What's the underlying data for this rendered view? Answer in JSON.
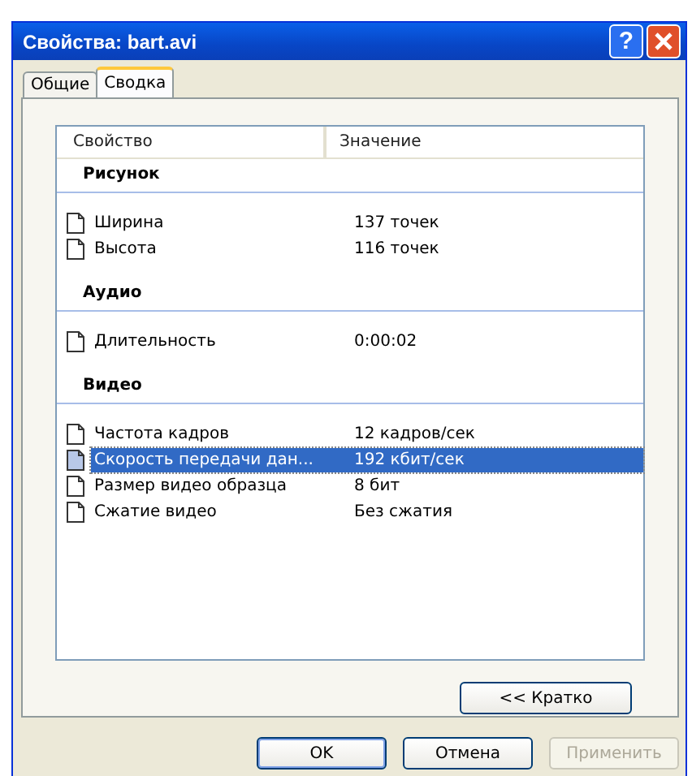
{
  "window": {
    "title": "Свойства: bart.avi",
    "help_label": "?"
  },
  "tabs": [
    {
      "label": "Общие",
      "selected": false
    },
    {
      "label": "Сводка",
      "selected": true
    }
  ],
  "list": {
    "columns": [
      "Свойство",
      "Значение"
    ],
    "groups": [
      {
        "title": "Рисунок",
        "rows": [
          {
            "name": "Ширина",
            "value": "137 точек",
            "selected": false
          },
          {
            "name": "Высота",
            "value": "116 точек",
            "selected": false
          }
        ]
      },
      {
        "title": "Аудио",
        "rows": [
          {
            "name": "Длительность",
            "value": "0:00:02",
            "selected": false
          }
        ]
      },
      {
        "title": "Видео",
        "rows": [
          {
            "name": "Частота кадров",
            "value": "12 кадров/сек",
            "selected": false
          },
          {
            "name": "Скорость передачи дан...",
            "value": "192 кбит/сек",
            "selected": true
          },
          {
            "name": "Размер видео образца",
            "value": "8 бит",
            "selected": false
          },
          {
            "name": "Сжатие видео",
            "value": "Без сжатия",
            "selected": false
          }
        ]
      }
    ]
  },
  "summary_button": "<< Кратко",
  "buttons": [
    {
      "label": "OK",
      "disabled": false,
      "default": true
    },
    {
      "label": "Отмена",
      "disabled": false,
      "default": false
    },
    {
      "label": "Применить",
      "disabled": true,
      "default": false
    }
  ]
}
